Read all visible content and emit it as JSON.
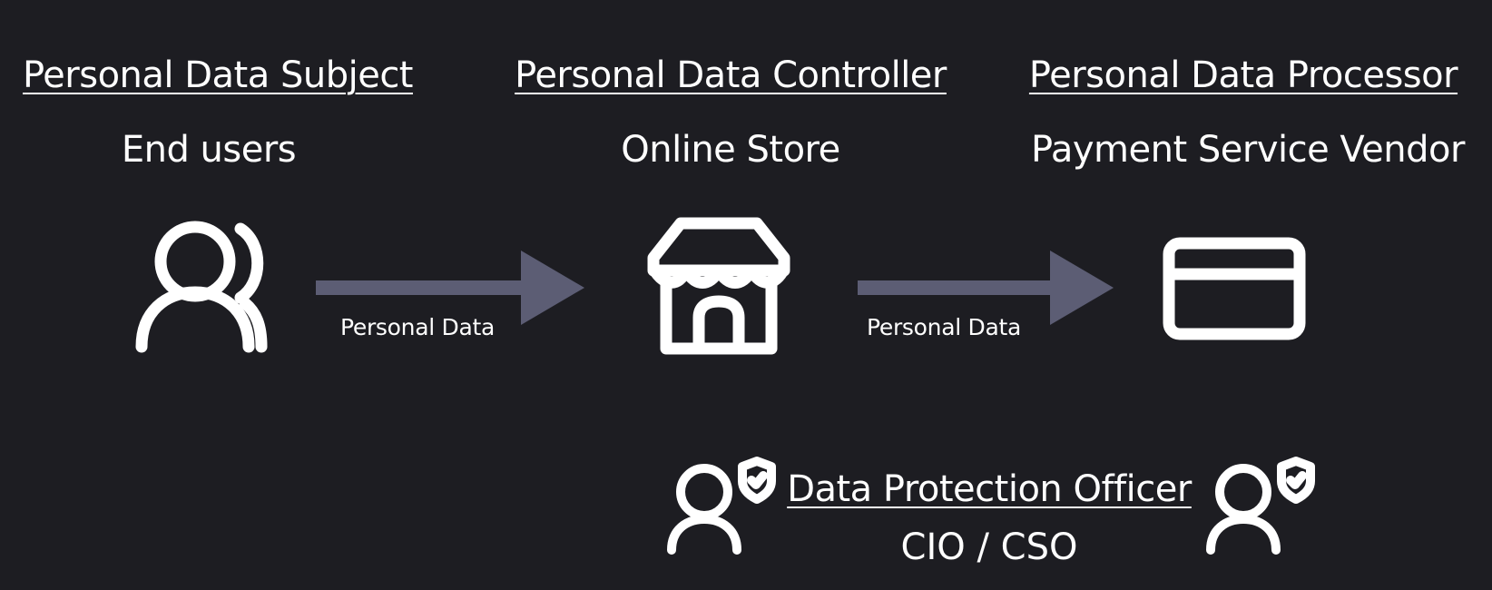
{
  "columns": [
    {
      "role": "Personal Data Subject",
      "entity": "End users",
      "icon": "users-icon"
    },
    {
      "role": "Personal Data Controller",
      "entity": "Online Store",
      "icon": "store-icon"
    },
    {
      "role": "Personal Data Processor",
      "entity": "Payment Service Vendor",
      "icon": "credit-card-icon"
    }
  ],
  "flows": [
    {
      "label": "Personal Data"
    },
    {
      "label": "Personal Data"
    }
  ],
  "dpo": {
    "title": "Data Protection Officer",
    "name": "CIO / CSO",
    "icon": "user-shield-icon"
  },
  "colors": {
    "background": "#1d1d22",
    "foreground": "#ffffff",
    "arrow": "#5c5d74"
  }
}
